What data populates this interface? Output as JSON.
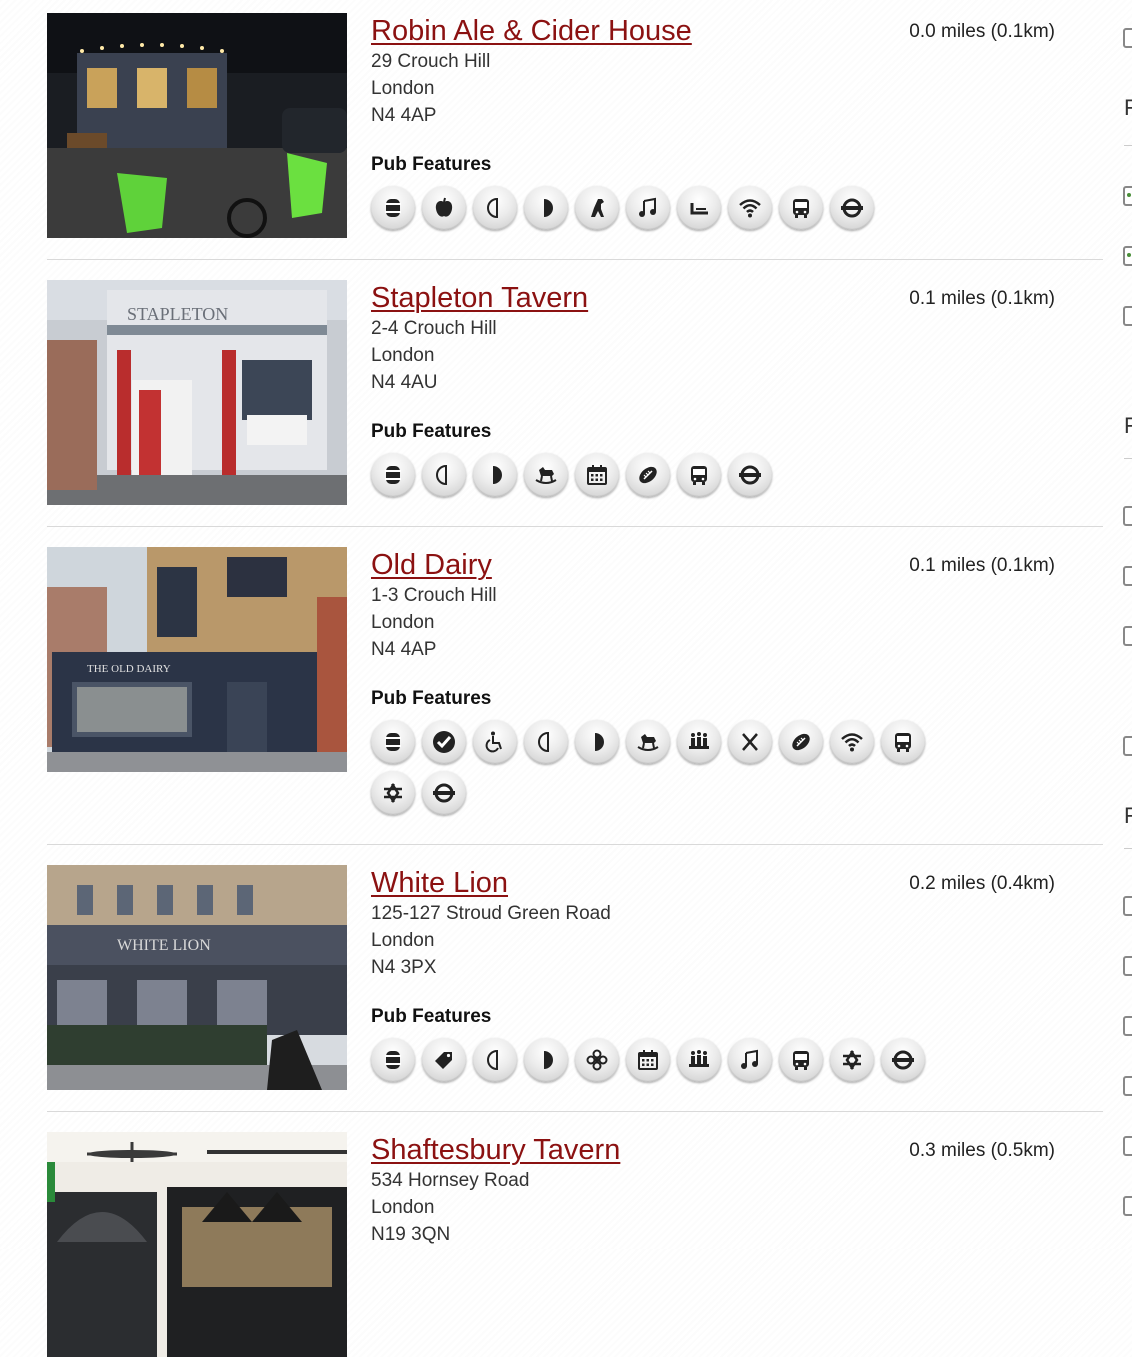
{
  "pubs": [
    {
      "name": "Robin Ale & Cider House",
      "distance": "0.0 miles (0.1km)",
      "address": [
        "29 Crouch Hill",
        "London",
        "N4 4AP"
      ],
      "features_title": "Pub Features",
      "features": [
        "real-ale-icon",
        "cider-icon",
        "half-moon-left-icon",
        "half-moon-right-icon",
        "dog-friendly-icon",
        "live-music-icon",
        "garden-icon",
        "wifi-icon",
        "bus-icon",
        "underground-icon"
      ]
    },
    {
      "name": "Stapleton Tavern",
      "distance": "0.1 miles (0.1km)",
      "address": [
        "2-4 Crouch Hill",
        "London",
        "N4 4AU"
      ],
      "features_title": "Pub Features",
      "features": [
        "real-ale-icon",
        "half-moon-left-icon",
        "half-moon-right-icon",
        "rocking-horse-icon",
        "events-calendar-icon",
        "sports-tv-icon",
        "bus-icon",
        "underground-icon"
      ]
    },
    {
      "name": "Old Dairy",
      "distance": "0.1 miles (0.1km)",
      "address": [
        "1-3 Crouch Hill",
        "London",
        "N4 4AP"
      ],
      "features_title": "Pub Features",
      "features": [
        "real-ale-icon",
        "checkmark-icon",
        "wheelchair-icon",
        "half-moon-left-icon",
        "half-moon-right-icon",
        "rocking-horse-icon",
        "function-room-icon",
        "food-icon",
        "sports-tv-icon",
        "wifi-icon",
        "bus-icon",
        "rail-icon",
        "underground-icon"
      ]
    },
    {
      "name": "White Lion",
      "distance": "0.2 miles (0.4km)",
      "address": [
        "125-127 Stroud Green Road",
        "London",
        "N4 3PX"
      ],
      "features_title": "Pub Features",
      "features": [
        "real-ale-icon",
        "price-tag-icon",
        "half-moon-left-icon",
        "half-moon-right-icon",
        "flower-icon",
        "events-calendar-icon",
        "function-room-icon",
        "live-music-icon",
        "bus-icon",
        "rail-icon",
        "underground-icon"
      ]
    },
    {
      "name": "Shaftesbury Tavern",
      "distance": "0.3 miles (0.5km)",
      "address": [
        "534 Hornsey Road",
        "London",
        "N19 3QN"
      ],
      "features_title": "Pub Features",
      "features": []
    }
  ],
  "sidebar": {
    "labels": [
      "F",
      "F",
      "F"
    ]
  }
}
